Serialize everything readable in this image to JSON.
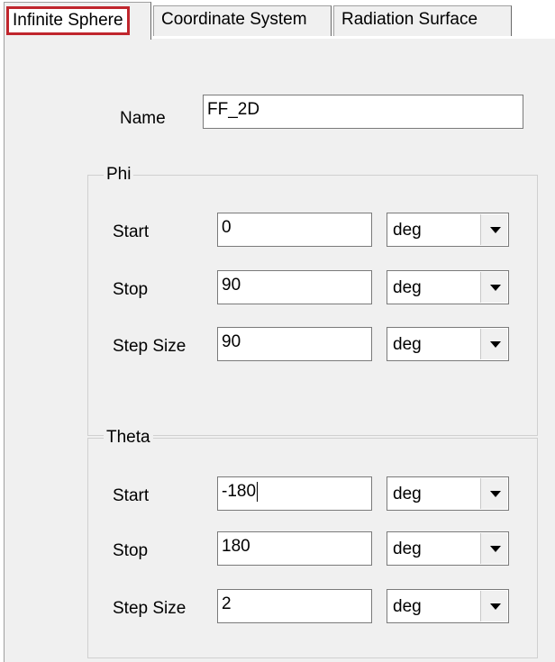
{
  "tabs": [
    {
      "label": "Infinite Sphere"
    },
    {
      "label": "Coordinate System"
    },
    {
      "label": "Radiation Surface"
    }
  ],
  "name": {
    "label": "Name",
    "value": "FF_2D"
  },
  "phi": {
    "title": "Phi",
    "rows": [
      {
        "label": "Start",
        "value": "0",
        "unit": "deg"
      },
      {
        "label": "Stop",
        "value": "90",
        "unit": "deg"
      },
      {
        "label": "Step Size",
        "value": "90",
        "unit": "deg"
      }
    ]
  },
  "theta": {
    "title": "Theta",
    "rows": [
      {
        "label": "Start",
        "value": "-180",
        "unit": "deg"
      },
      {
        "label": "Stop",
        "value": "180",
        "unit": "deg"
      },
      {
        "label": "Step Size",
        "value": "2",
        "unit": "deg"
      }
    ]
  }
}
